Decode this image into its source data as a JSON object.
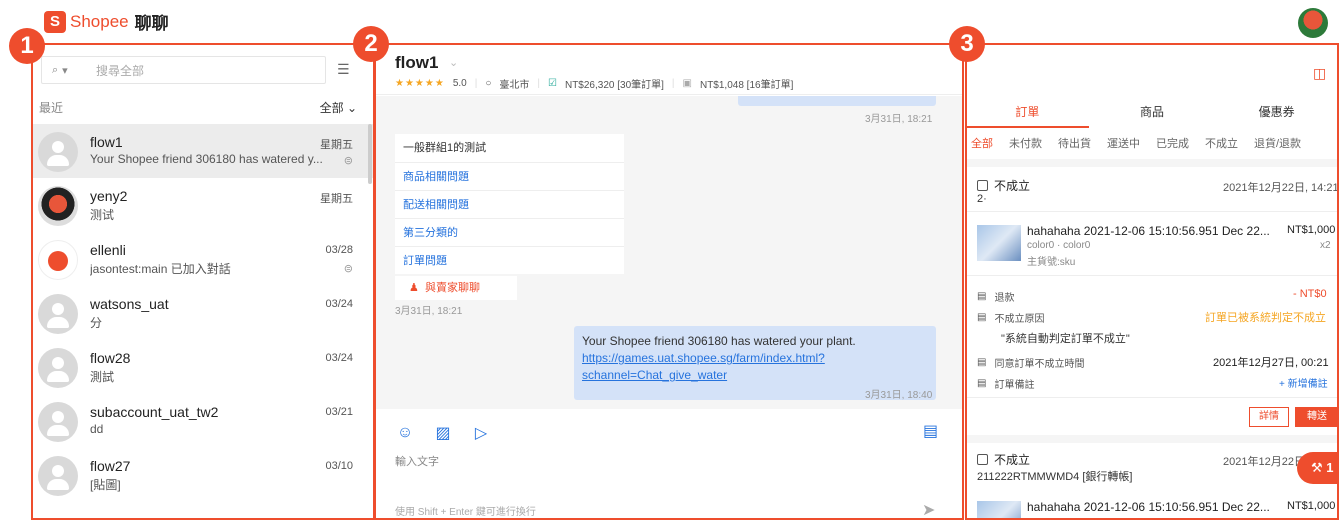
{
  "app": {
    "brand": "Shopee",
    "title": "聊聊"
  },
  "badges": [
    "1",
    "2",
    "3"
  ],
  "sidebar": {
    "search_scope_icon": "search-icon",
    "search_placeholder": "搜尋全部",
    "recent_label": "最近",
    "all_label": "全部",
    "conversations": [
      {
        "name": "flow1",
        "message": "Your Shopee friend 306180 has watered y...",
        "date": "星期五",
        "status_icon": "read-icon",
        "status": "⊜"
      },
      {
        "name": "yeny2",
        "message": "测试",
        "date": "星期五",
        "status": ""
      },
      {
        "name": "ellenli",
        "message": "jasontest:main 已加入對話",
        "date": "03/28",
        "status": "⊜"
      },
      {
        "name": "watsons_uat",
        "message": "分",
        "date": "03/24",
        "status": ""
      },
      {
        "name": "flow28",
        "message": "測試",
        "date": "03/24",
        "status": ""
      },
      {
        "name": "subaccount_uat_tw2",
        "message": "dd",
        "date": "03/21",
        "status": ""
      },
      {
        "name": "flow27",
        "message": "[貼圖]",
        "date": "03/10",
        "status": ""
      }
    ]
  },
  "chat": {
    "name": "flow1",
    "rating": "5.0",
    "stars": "★★★★★",
    "location": "臺北市",
    "completed_orders": "NT$26,320 [30筆訂單]",
    "other_orders": "NT$1,048 [16筆訂單]",
    "time1": "3月31日, 18:21",
    "menu_title": "一般群組1的測試",
    "menu_items": [
      "商品相關問題",
      "配送相關問題",
      "第三分類的",
      "訂單問題"
    ],
    "contact_seller": "與賣家聊聊",
    "time2": "3月31日, 18:21",
    "message_text": "Your Shopee friend 306180 has watered your plant.",
    "message_link": "https://games.uat.shopee.sg/farm/index.html?schannel=Chat_give_water",
    "message_link_l1": "https://games.uat.shopee.sg/farm/index.html?",
    "message_link_l2": "schannel=Chat_give_water",
    "time3": "3月31日, 18:40",
    "input_placeholder": "輸入文字",
    "hint": "使用 Shift + Enter 鍵可進行換行"
  },
  "panel": {
    "tabs": [
      "訂單",
      "商品",
      "優惠券"
    ],
    "subtabs": [
      "全部",
      "未付款",
      "待出貨",
      "運送中",
      "已完成",
      "不成立",
      "退貨/退款"
    ],
    "order1": {
      "status": "不成立",
      "date": "2021年12月22日, 14:21",
      "id": "2·",
      "product": "hahahaha 2021-12-06 15:10:56.951 Dec 22...",
      "variant": "color0 · color0",
      "sku": "主貨號:sku",
      "price": "NT$1,000",
      "qty": "x2",
      "refund_label": "退款",
      "refund_value": "- NT$0",
      "reason_label": "不成立原因",
      "reason_value": "訂單已被系統判定不成立",
      "reason_quote": "\"系統自動判定訂單不成立\"",
      "agree_label": "同意訂單不成立時間",
      "agree_value": "2021年12月27日, 00:21",
      "note_label": "訂單備註",
      "note_value": "+ 新增備註",
      "detail_btn": "詳情",
      "ship_btn": "轉送"
    },
    "order2": {
      "status": "不成立",
      "date": "2021年12月22日",
      "id": "211222RTMMWMD4 [銀行轉帳]",
      "product": "hahahaha 2021-12-06 15:10:56.951 Dec 22...",
      "price": "NT$1,000"
    }
  },
  "colors": {
    "brand": "#ee4d2d",
    "link": "#2673dd",
    "bubble": "#d4e2f8"
  }
}
